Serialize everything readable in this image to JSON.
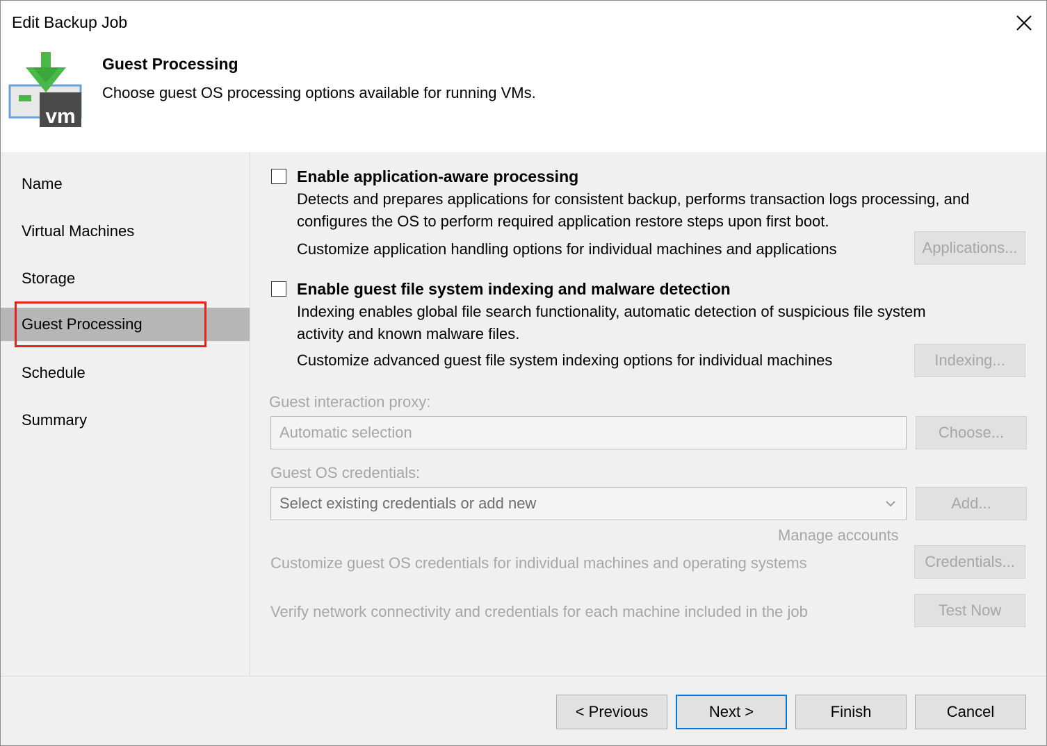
{
  "window": {
    "title": "Edit Backup Job"
  },
  "header": {
    "title": "Guest Processing",
    "subtitle": "Choose guest OS processing options available for running VMs.",
    "icon_label": "vm"
  },
  "nav": {
    "items": [
      {
        "label": "Name"
      },
      {
        "label": "Virtual Machines"
      },
      {
        "label": "Storage"
      },
      {
        "label": "Guest Processing"
      },
      {
        "label": "Schedule"
      },
      {
        "label": "Summary"
      }
    ],
    "active_index": 3
  },
  "app_aware": {
    "label": "Enable application-aware processing",
    "checked": false,
    "desc_line1": "Detects and prepares applications for consistent backup, performs transaction logs processing, and",
    "desc_line2": "configures the OS to perform required application restore steps upon first boot.",
    "customize_text": "Customize application handling options for individual machines and applications",
    "button": "Applications..."
  },
  "indexing": {
    "label": "Enable guest file system indexing and malware detection",
    "checked": false,
    "desc_line1": "Indexing enables global file search functionality, automatic detection of suspicious file system",
    "desc_line2": "activity and known malware files.",
    "customize_text": "Customize advanced guest file system indexing options for individual machines",
    "button": "Indexing..."
  },
  "proxy": {
    "label": "Guest interaction proxy:",
    "value": "Automatic selection",
    "button": "Choose..."
  },
  "credentials": {
    "label": "Guest OS credentials:",
    "placeholder": "Select existing credentials or add new",
    "add_button": "Add...",
    "manage_link": "Manage accounts",
    "customize_text": "Customize guest OS credentials for individual machines and operating systems",
    "credentials_button": "Credentials...",
    "verify_text": "Verify network connectivity and credentials for each machine included in the job",
    "test_button": "Test Now"
  },
  "footer": {
    "previous": "< Previous",
    "next": "Next >",
    "finish": "Finish",
    "cancel": "Cancel"
  },
  "colors": {
    "accent": "#0078d7",
    "highlight": "#e2231a",
    "icon_green": "#49b849",
    "nav_active": "#b6b6b6"
  }
}
